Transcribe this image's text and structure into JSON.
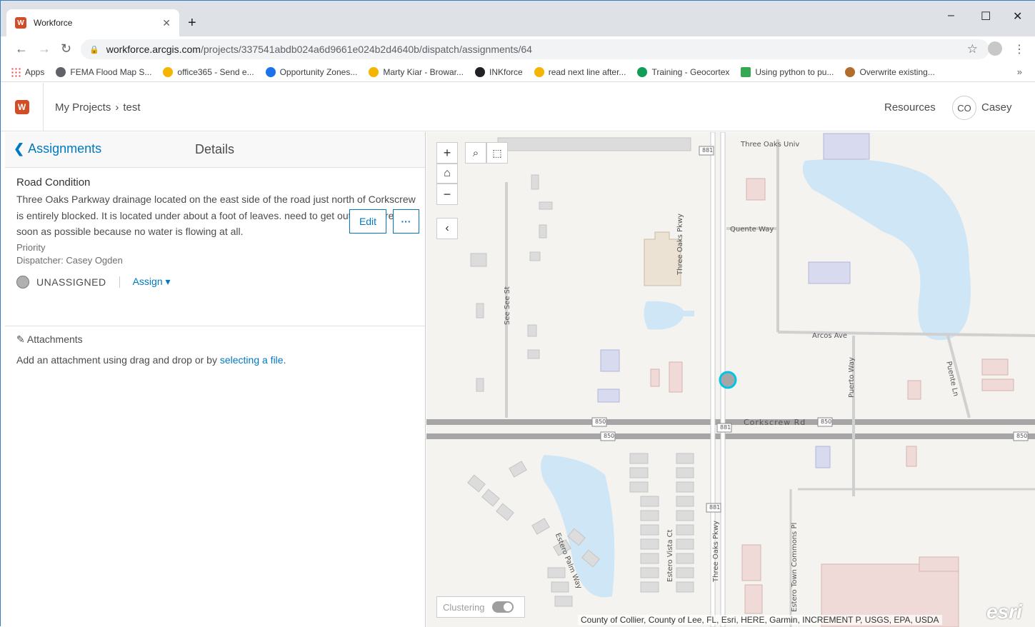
{
  "browser": {
    "tab_title": "Workforce",
    "tab_close": "✕",
    "new_tab": "+",
    "url_host": "workforce.arcgis.com",
    "url_path": "/projects/337541abdb024a6d9661e024b2d4640b/dispatch/assignments/64",
    "bookmarks": [
      "Apps",
      "FEMA Flood Map S...",
      "office365 - Send e...",
      "Opportunity Zones...",
      "Marty Kiar - Browar...",
      "INKforce",
      "read next line after...",
      "Training - Geocortex",
      "Using python to pu...",
      "Overwrite existing..."
    ],
    "bookmark_colors": [
      "#e8453c",
      "#5f6368",
      "#f4b400",
      "#1a73e8",
      "#f4b400",
      "#202124",
      "#f4b400",
      "#0f9d58",
      "#34a853",
      "#b06d2b"
    ],
    "bookmarks_more": "»"
  },
  "header": {
    "crumb_root": "My Projects",
    "crumb_sep": "›",
    "crumb_project": "test",
    "resources": "Resources",
    "avatar_initials": "CO",
    "user_name": "Casey"
  },
  "panel": {
    "back_label": "Assignments",
    "details_title": "Details",
    "assignment_type": "Road Condition",
    "description": "Three Oaks Parkway drainage located on the east side of the road just north of Corkscrew is entirely blocked. It is located under about a foot of leaves. need to get out there are soon as possible because no water is flowing at all.",
    "priority": "Priority",
    "dispatcher": "Dispatcher: Casey Ogden",
    "edit_label": "Edit",
    "more_label": "···",
    "status": "UNASSIGNED",
    "assign_label": "Assign ▾",
    "attachments_label": "Attachments",
    "attach_text": "Add an attachment using drag and drop or by ",
    "attach_link": "selecting a file",
    "attach_end": "."
  },
  "map": {
    "clustering_label": "Clustering",
    "attribution": "County of Collier, County of Lee, FL, Esri, HERE, Garmin, INCREMENT P, USGS, EPA, USDA",
    "esri": "esri",
    "labels": {
      "three_oaks_univ": "Three Oaks Univ",
      "quente_way": "Quente Way",
      "three_oaks_pkwy": "Three Oaks Pkwy",
      "see_see_st": "See See St",
      "arcos_ave": "Arcos Ave",
      "puerto_way": "Puerto Way",
      "puente_ln": "Puente Ln",
      "corkscrew_rd": "Corkscrew Rd",
      "estero_palm_way": "Estero Palm Way",
      "estero_vista_ct": "Estero Vista Ct",
      "three_oaks_pkwy_2": "Three Oaks Pkwy",
      "estero_town_commons": "Estero Town Commons Pl",
      "shield_881": "881",
      "shield_850": "850"
    },
    "assignment_marker_color": "#00c5e6"
  }
}
